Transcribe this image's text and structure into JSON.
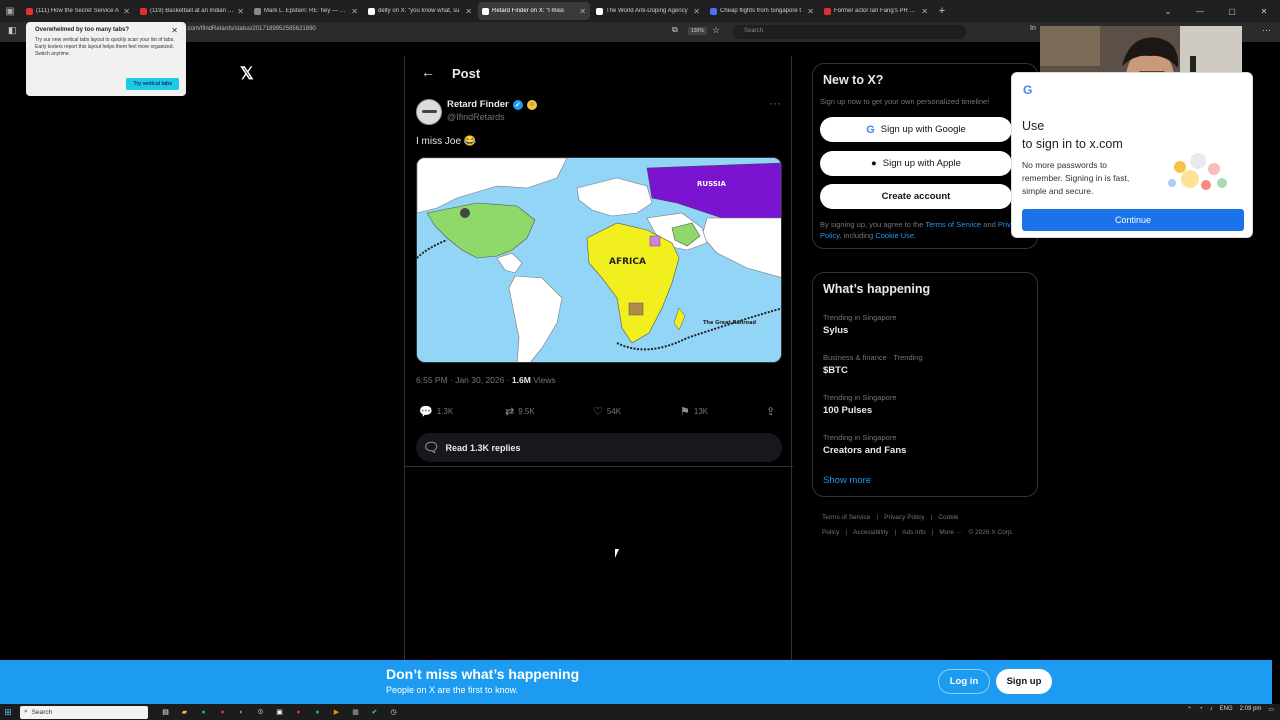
{
  "browser": {
    "tabs": [
      {
        "title": "(111) How the Secret Service A",
        "color": "#e03131",
        "active": false
      },
      {
        "title": "(119) Basketball at an Indian Th",
        "color": "#e03131",
        "active": false
      },
      {
        "title": "Mark L. Epstein: RE: hey — Epst",
        "color": "#888888",
        "active": false
      },
      {
        "title": "delty on X: \"you know what, su",
        "color": "#ffffff",
        "active": false
      },
      {
        "title": "Retard Finder on X: \"I miss",
        "color": "#ffffff",
        "active": true
      },
      {
        "title": "The World Anti-Doping Agency",
        "color": "#ffffff",
        "active": false
      },
      {
        "title": "Cheap flights from Singapore t",
        "color": "#4c6ef5",
        "active": false
      },
      {
        "title": "Former actor Ian Fang's PR star",
        "color": "#e03131",
        "active": false
      }
    ],
    "url": ".com/IfindRetards/status/2017189952585621890",
    "zoom": "130%",
    "search_placeholder": "Search"
  },
  "tab_popup": {
    "title": "Overwhelmed by too many tabs?",
    "body": "Try our new vertical tabs layout to quickly scan your list of tabs. Early testers report this layout helps them feel more organized. Switch anytime.",
    "button": "Try vertical tabs"
  },
  "post": {
    "header": "Post",
    "display_name": "Retard Finder",
    "handle": "@IfindRetards",
    "text": "I miss Joe 😂",
    "map_labels": {
      "russia": "RUSSIA",
      "africa": "AFRICA",
      "railroad": "The Great Railroad"
    },
    "time": "6:55 PM · Jan 30, 2026 · ",
    "views_count": "1.6M",
    "views_label": " Views",
    "stats": {
      "replies": "1.3K",
      "reposts": "9.5K",
      "likes": "54K",
      "bookmarks": "13K"
    },
    "read_replies": "Read 1.3K replies"
  },
  "signup_box": {
    "title": "New to X?",
    "subtitle": "Sign up now to get your own personalized timeline!",
    "google": "Sign up with Google",
    "apple": "Sign up with Apple",
    "create": "Create account",
    "legal_pre": "By signing up, you agree to the ",
    "terms": "Terms of Service",
    "legal_mid": " and ",
    "privacy": "Privacy Policy",
    "legal_mid2": ", including ",
    "cookie": "Cookie Use."
  },
  "trends": {
    "title": "What’s happening",
    "items": [
      {
        "category": "Trending in Singapore",
        "name": "Sylus"
      },
      {
        "category": "Business & finance · Trending",
        "name": "$BTC"
      },
      {
        "category": "Trending in Singapore",
        "name": "100 Pulses"
      },
      {
        "category": "Trending in Singapore",
        "name": "Creators and Fans"
      }
    ],
    "show_more": "Show more"
  },
  "footer_links": [
    "Terms of Service",
    "|",
    "Privacy Policy",
    "|",
    "Cookie Policy",
    "|",
    "Accessibility",
    "|",
    "Ads info",
    "|",
    "More ···",
    "© 2026 X Corp."
  ],
  "google_popup": {
    "title_line1": "Use",
    "title_line2": "to sign in to x.com",
    "body": "No more passwords to remember. Signing in is fast, simple and secure.",
    "button": "Continue"
  },
  "banner": {
    "title": "Don’t miss what’s happening",
    "subtitle": "People on X are the first to know.",
    "login": "Log in",
    "signup": "Sign up"
  },
  "taskbar": {
    "search": "Search",
    "lang": "ENG",
    "time": "2:09 pm"
  },
  "colors": {
    "accent": "#1d9bf0",
    "background": "#000000",
    "banner": "#1d9bf0"
  }
}
